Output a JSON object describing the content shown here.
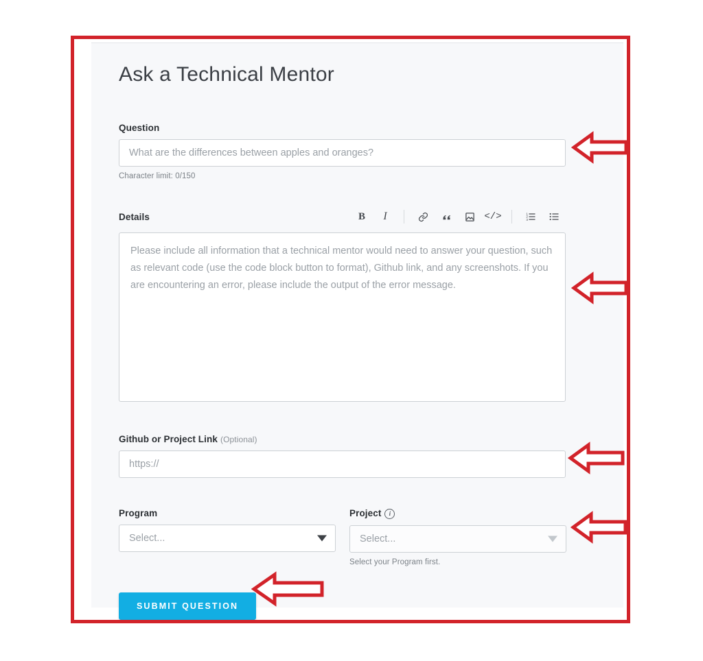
{
  "page": {
    "title": "Ask a Technical Mentor"
  },
  "question": {
    "label": "Question",
    "placeholder": "What are the differences between apples and oranges?",
    "value": "",
    "char_limit_text": "Character limit: 0/150"
  },
  "details": {
    "label": "Details",
    "placeholder": "Please include all information that a technical mentor would need to answer your question, such as relevant code (use the code block button to format), Github link, and any screenshots. If you are encountering an error, please include the output of the error message.",
    "value": "",
    "toolbar": [
      {
        "name": "bold-icon",
        "glyph": "B"
      },
      {
        "name": "italic-icon",
        "glyph": "I"
      },
      {
        "name": "link-icon",
        "glyph": "link"
      },
      {
        "name": "quote-icon",
        "glyph": "”"
      },
      {
        "name": "image-icon",
        "glyph": "image"
      },
      {
        "name": "code-block-icon",
        "glyph": "</>"
      },
      {
        "name": "ordered-list-icon",
        "glyph": "ol"
      },
      {
        "name": "unordered-list-icon",
        "glyph": "ul"
      }
    ]
  },
  "github_link": {
    "label": "Github or Project Link",
    "optional_tag": "(Optional)",
    "placeholder": "https://",
    "value": ""
  },
  "program": {
    "label": "Program",
    "selected": "Select...",
    "options": [
      "Select..."
    ]
  },
  "project": {
    "label": "Project",
    "info_icon": "info-icon",
    "selected": "Select...",
    "options": [
      "Select..."
    ],
    "helper_text": "Select your Program first."
  },
  "submit": {
    "label": "SUBMIT QUESTION"
  },
  "colors": {
    "submit_button": "#12aee3",
    "annotation_red": "#d2232a",
    "card_background": "#f7f8fa",
    "input_border": "#ccd0d4",
    "placeholder_text": "#9aa0a6"
  },
  "annotations": {
    "arrows": [
      {
        "name": "arrow-question-field",
        "direction": "left"
      },
      {
        "name": "arrow-details-field",
        "direction": "left"
      },
      {
        "name": "arrow-github-link-field",
        "direction": "left"
      },
      {
        "name": "arrow-project-select",
        "direction": "left"
      },
      {
        "name": "arrow-submit-button",
        "direction": "left"
      }
    ]
  }
}
